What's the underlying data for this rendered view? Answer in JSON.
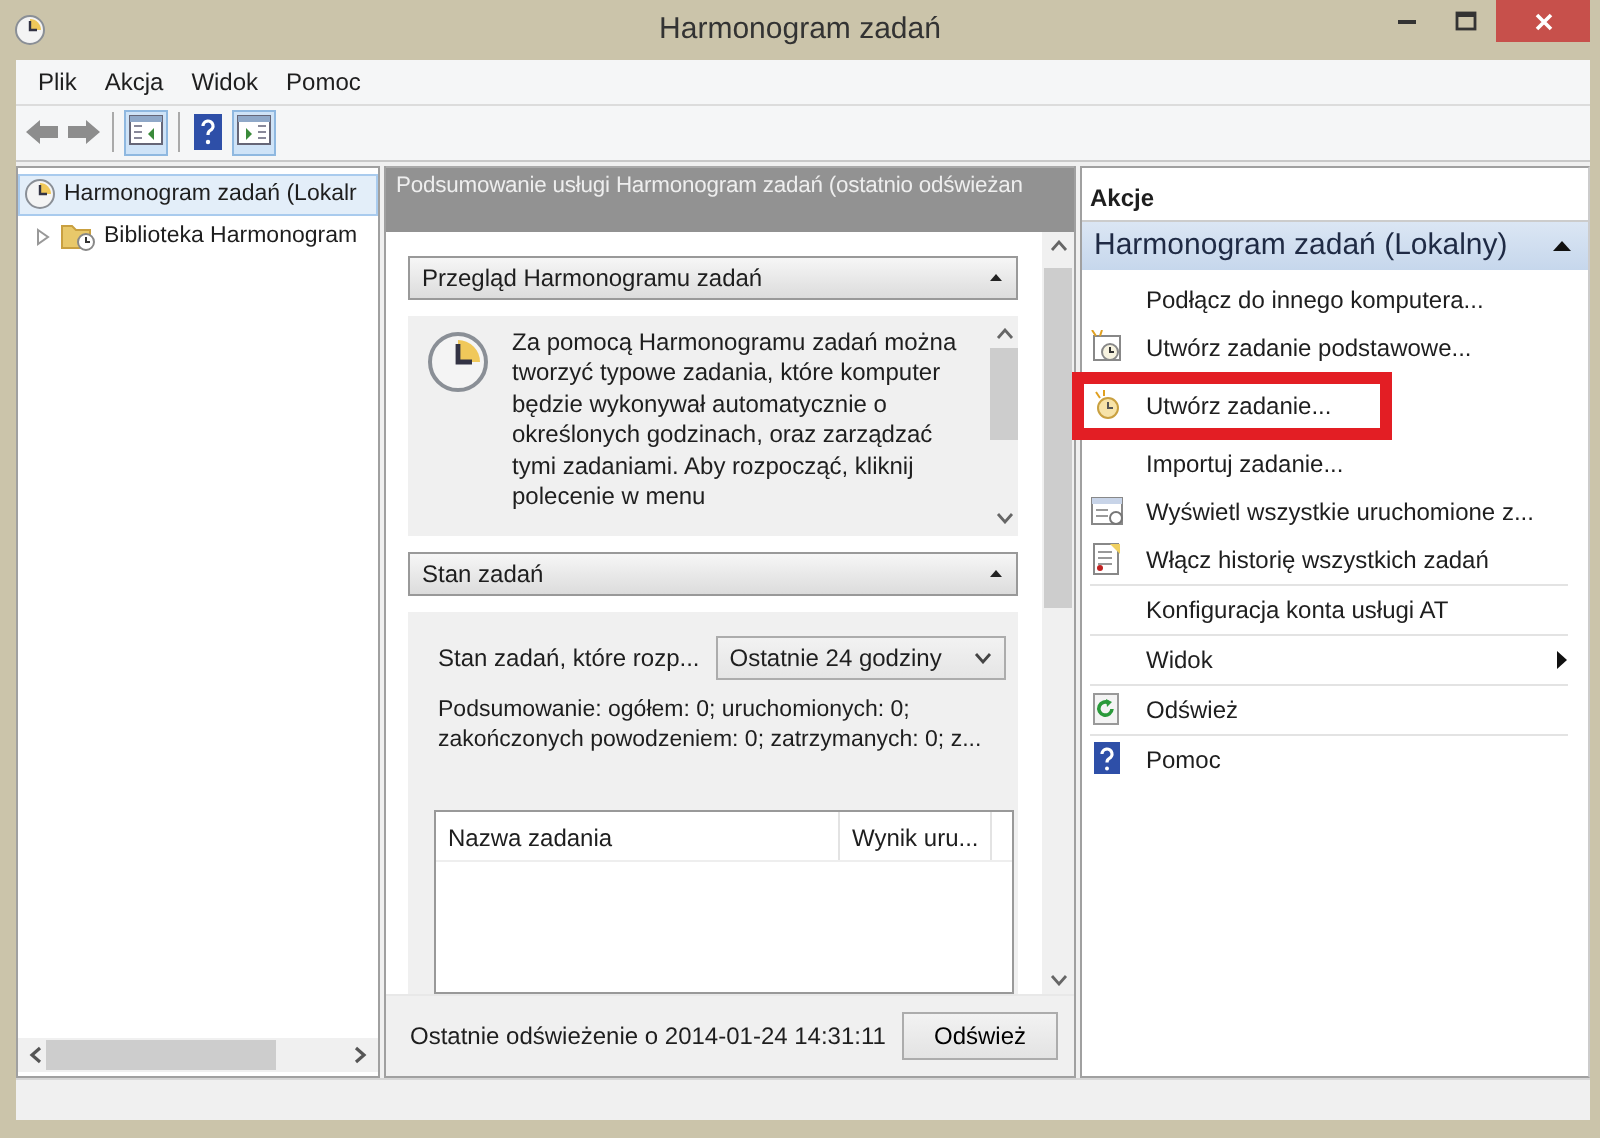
{
  "window": {
    "title": "Harmonogram zadań"
  },
  "menu": [
    "Plik",
    "Akcja",
    "Widok",
    "Pomoc"
  ],
  "tree": [
    {
      "label": "Harmonogram zadań (Lokalr",
      "selected": true,
      "children": [
        {
          "label": "Biblioteka Harmonogram",
          "selected": false,
          "expanded": false
        }
      ]
    }
  ],
  "summary": {
    "header": "Podsumowanie usługi Harmonogram zadań (ostatnio odświeżan",
    "overview": {
      "title": "Przegląd Harmonogramu zadań",
      "expanded": true,
      "text": "Za pomocą Harmonogramu zadań można tworzyć typowe zadania, które komputer będzie wykonywał automatycznie o określonych godzinach, oraz zarządzać tymi zadaniami. Aby rozpocząć, kliknij polecenie w menu"
    },
    "status": {
      "title": "Stan zadań",
      "expanded": true,
      "filter_label": "Stan zadań, które rozp...",
      "filter_value": "Ostatnie 24 godziny",
      "text": "Podsumowanie: ogółem: 0; uruchomionych: 0; zakończonych powodzeniem: 0; zatrzymanych: 0; z...",
      "columns": [
        "Nazwa zadania",
        "Wynik uru..."
      ]
    },
    "footer": {
      "text": "Ostatnie odświeżenie o 2014-01-24 14:31:11",
      "button": "Odśwież"
    }
  },
  "actions": {
    "title": "Akcje",
    "group": "Harmonogram zadań (Lokalny)",
    "items": [
      {
        "label": "Podłącz do innego komputera...",
        "kind": "plain",
        "separator": false,
        "highlighted": false
      },
      {
        "label": "Utwórz zadanie podstawowe...",
        "kind": "wizard",
        "separator": false,
        "highlighted": false
      },
      {
        "label": "Utwórz zadanie...",
        "kind": "task",
        "separator": false,
        "highlighted": true
      },
      {
        "label": "Importuj zadanie...",
        "kind": "plain",
        "separator": false,
        "highlighted": false
      },
      {
        "label": "Wyświetl wszystkie uruchomione z...",
        "kind": "list",
        "separator": false,
        "highlighted": false
      },
      {
        "label": "Włącz historię wszystkich zadań",
        "kind": "notes",
        "separator": true,
        "highlighted": false
      },
      {
        "label": "Konfiguracja konta usługi AT",
        "kind": "plain",
        "separator": true,
        "highlighted": false
      },
      {
        "label": "Widok",
        "kind": "submenu",
        "separator": true,
        "highlighted": false
      },
      {
        "label": "Odśwież",
        "kind": "refresh",
        "separator": true,
        "highlighted": false
      },
      {
        "label": "Pomoc",
        "kind": "help",
        "separator": false,
        "highlighted": false
      }
    ]
  }
}
